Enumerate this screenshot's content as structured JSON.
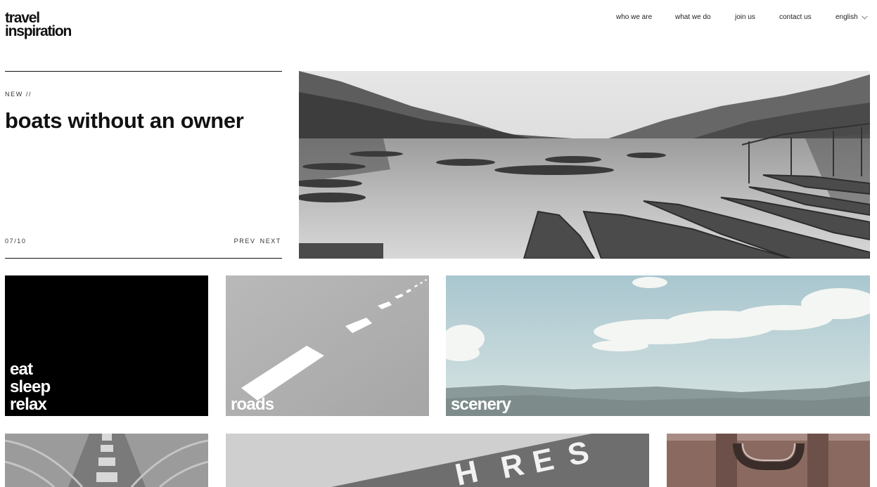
{
  "logo": {
    "line1": "travel",
    "line2": "inspiration"
  },
  "nav": {
    "items": [
      "who we are",
      "what we do",
      "join us",
      "contact us"
    ],
    "language": "english",
    "language_icon": "chevron-down-icon"
  },
  "hero": {
    "kicker": "NEW //",
    "title": "boats without an owner",
    "counter": "07/10",
    "prev": "PREV",
    "next": "NEXT",
    "image": "black-and-white photo of rowing boats on a mountain lake"
  },
  "tiles": {
    "eat": {
      "label": "eat\nsleep\nrelax",
      "color": "#000000"
    },
    "roads": {
      "label": "roads",
      "image": "grey asphalt road with white dashed line"
    },
    "scenery": {
      "label": "scenery",
      "image": "pale sky with clouds above distant hills"
    },
    "row3": [
      {
        "image": "grey tunnel ceiling with lights"
      },
      {
        "image": "grey sign with large white letters"
      },
      {
        "image": "brown vintage suitcase handle"
      }
    ]
  }
}
